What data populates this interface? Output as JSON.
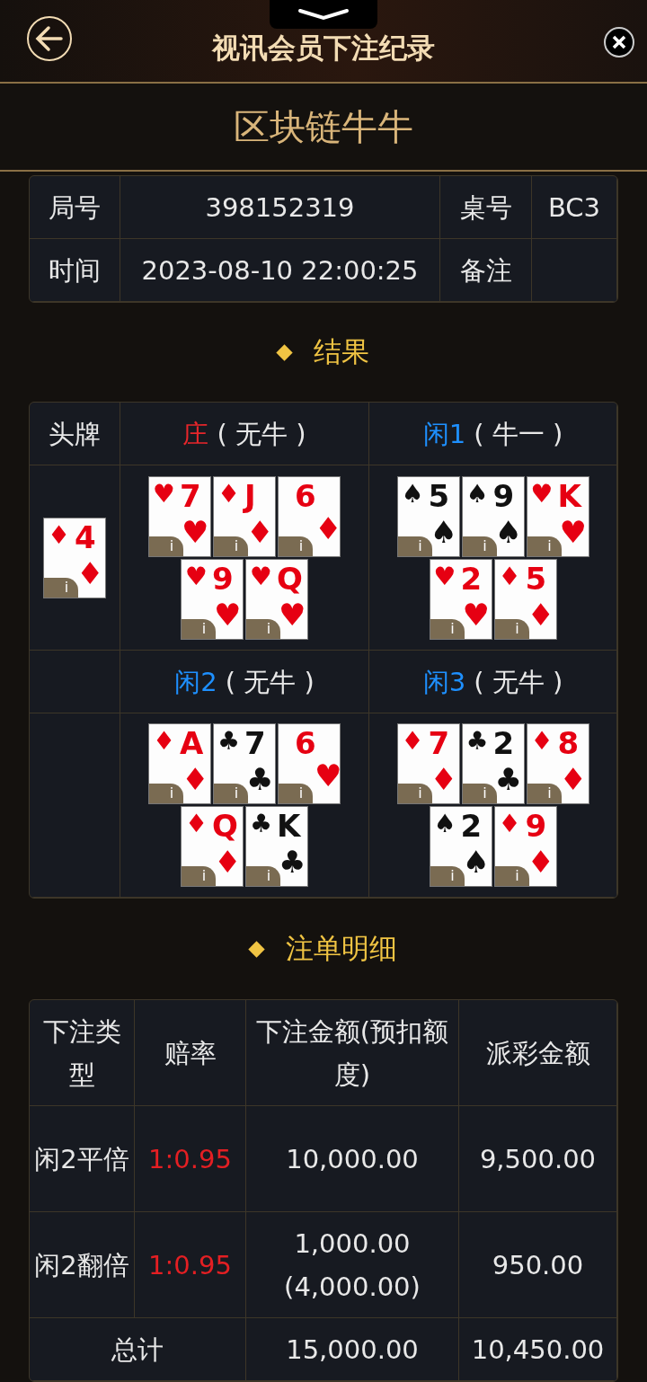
{
  "header": {
    "title": "视讯会员下注纪录"
  },
  "game": {
    "title": "区块链牛牛"
  },
  "info": [
    {
      "label": "局号",
      "value": "398152319",
      "label2": "桌号",
      "value2": "BC3"
    },
    {
      "label": "时间",
      "value": "2023-08-10 22:00:25",
      "label2": "备注"
    }
  ],
  "result_title": "结果",
  "head_card": {
    "label": "头牌",
    "card": {
      "rank": "4",
      "suit": "♦",
      "color": "#e60012",
      "kind": "corner",
      "badge": "i"
    }
  },
  "hands": [
    {
      "name": "庄",
      "color": "#e8262b",
      "result": "( 无牛 )",
      "cards": [
        {
          "rank": "7",
          "suit": "♥",
          "color": "#e60012",
          "kind": "corner",
          "badge": "i"
        },
        {
          "rank": "J",
          "suit": "♦",
          "color": "#e60012",
          "kind": "corner",
          "badge": "i"
        },
        {
          "rank": "6",
          "suit": "♦",
          "color": "#e60012",
          "kind": "plain",
          "badge": "i"
        },
        {
          "rank": "9",
          "suit": "♥",
          "color": "#e60012",
          "kind": "corner",
          "badge": "i"
        },
        {
          "rank": "Q",
          "suit": "♥",
          "color": "#e60012",
          "kind": "corner",
          "badge": "i"
        }
      ]
    },
    {
      "name": "闲1",
      "color": "#1e90ff",
      "result": "( 牛一 )",
      "cards": [
        {
          "rank": "5",
          "suit": "♠",
          "color": "#111111",
          "kind": "corner",
          "badge": "i"
        },
        {
          "rank": "9",
          "suit": "♠",
          "color": "#111111",
          "kind": "corner",
          "badge": "i"
        },
        {
          "rank": "K",
          "suit": "♥",
          "color": "#e60012",
          "kind": "corner",
          "badge": "i"
        },
        {
          "rank": "2",
          "suit": "♥",
          "color": "#e60012",
          "kind": "corner",
          "badge": "i"
        },
        {
          "rank": "5",
          "suit": "♦",
          "color": "#e60012",
          "kind": "corner",
          "badge": "i"
        }
      ]
    },
    {
      "name": "闲2",
      "color": "#1e90ff",
      "result": "( 无牛 )",
      "cards": [
        {
          "rank": "A",
          "suit": "♦",
          "color": "#e60012",
          "kind": "corner",
          "badge": "i"
        },
        {
          "rank": "7",
          "suit": "♣",
          "color": "#111111",
          "kind": "corner",
          "badge": "i"
        },
        {
          "rank": "6",
          "suit": "♥",
          "color": "#e60012",
          "kind": "plain",
          "badge": "i"
        },
        {
          "rank": "Q",
          "suit": "♦",
          "color": "#e60012",
          "kind": "corner",
          "badge": "i"
        },
        {
          "rank": "K",
          "suit": "♣",
          "color": "#111111",
          "kind": "corner",
          "badge": "i"
        }
      ]
    },
    {
      "name": "闲3",
      "color": "#1e90ff",
      "result": "( 无牛 )",
      "cards": [
        {
          "rank": "7",
          "suit": "♦",
          "color": "#e60012",
          "kind": "corner",
          "badge": "i"
        },
        {
          "rank": "2",
          "suit": "♣",
          "color": "#111111",
          "kind": "corner",
          "badge": "i"
        },
        {
          "rank": "8",
          "suit": "♦",
          "color": "#e60012",
          "kind": "corner",
          "badge": "i"
        },
        {
          "rank": "2",
          "suit": "♠",
          "color": "#111111",
          "kind": "corner",
          "badge": "i"
        },
        {
          "rank": "9",
          "suit": "♦",
          "color": "#e60012",
          "kind": "corner",
          "badge": "i"
        }
      ]
    }
  ],
  "bets_title": "注单明细",
  "bets": {
    "columns": [
      "下注类型",
      "赔率",
      "下注金额(预扣额度)",
      "派彩金额"
    ],
    "rows": [
      {
        "type": "闲2平倍",
        "odds": "1:0.95",
        "amount": "10,000.00",
        "payout": "9,500.00"
      },
      {
        "type": "闲2翻倍",
        "odds": "1:0.95",
        "amount": "1,000.00",
        "held": "(4,000.00)",
        "payout": "950.00"
      }
    ],
    "total": {
      "label": "总计",
      "amount": "15,000.00",
      "payout": "10,450.00"
    }
  }
}
